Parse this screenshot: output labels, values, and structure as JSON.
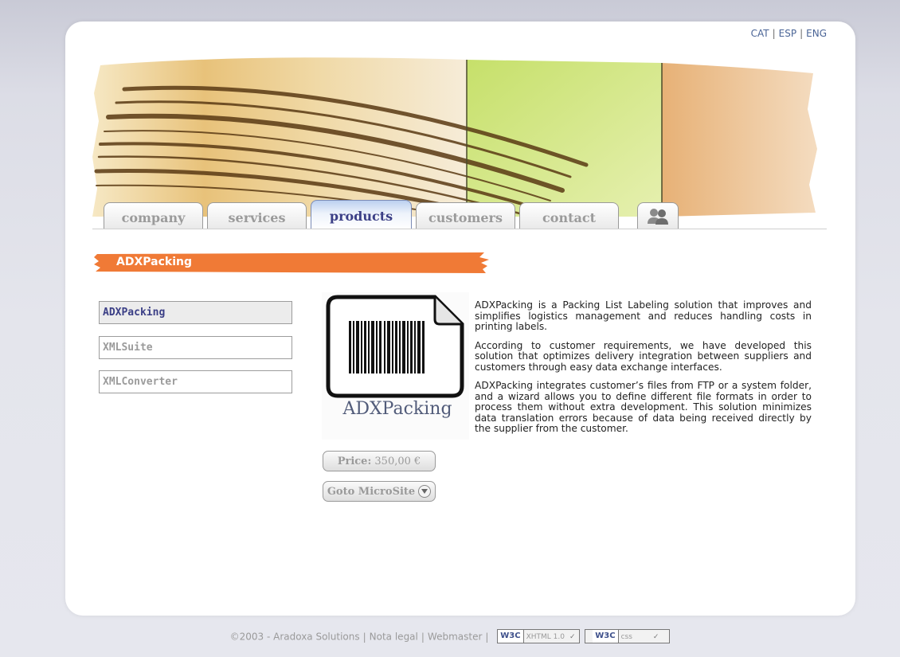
{
  "languages": [
    "CAT",
    "ESP",
    "ENG"
  ],
  "tabs": [
    {
      "label": "company"
    },
    {
      "label": "services"
    },
    {
      "label": "products"
    },
    {
      "label": "customers"
    },
    {
      "label": "contact"
    }
  ],
  "section_title": "ADXPacking",
  "sidebar": {
    "items": [
      {
        "label": "ADXPacking"
      },
      {
        "label": "XMLSuite"
      },
      {
        "label": "XMLConverter"
      }
    ]
  },
  "product": {
    "logo_text": "ADXPacking",
    "price_label": "Price:",
    "price_value": "350,00 €",
    "microsite_label": "Goto MicroSite"
  },
  "description": [
    "ADXPacking is a Packing List Labeling solution that improves and simplifies logistics management and reduces handling costs in printing labels.",
    "According to customer requirements, we have developed this solution that optimizes delivery integration between suppliers and customers through easy data exchange interfaces.",
    "ADXPacking integrates customer’s files from FTP or a system folder, and a wizard allows you to define different file formats in order to process them without extra development. This solution minimizes data translation errors because of data being received directly by the supplier from the customer."
  ],
  "footer": {
    "copyright": "©2003 - Aradoxa Solutions",
    "legal": "Nota legal",
    "webmaster": "Webmaster",
    "badge_w3c": "W3C",
    "badge_xhtml": "XHTML 1.0",
    "badge_css": "css",
    "badge_check": "✓"
  },
  "colors": {
    "accent_orange": "#f07a36",
    "active_tab_text": "#3b3f86",
    "inactive_text": "#9b9b9b"
  }
}
